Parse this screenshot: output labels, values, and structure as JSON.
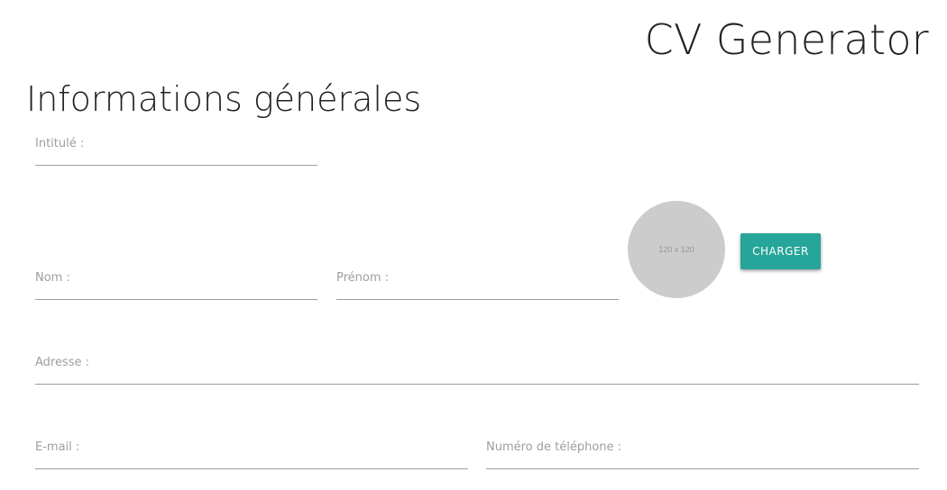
{
  "header": {
    "app_title": "CV Generator"
  },
  "section": {
    "title": "Informations générales"
  },
  "form": {
    "intitule": {
      "label": "Intitulé :",
      "value": ""
    },
    "nom": {
      "label": "Nom :",
      "value": ""
    },
    "prenom": {
      "label": "Prénom :",
      "value": ""
    },
    "adresse": {
      "label": "Adresse :",
      "value": ""
    },
    "email": {
      "label": "E-mail :",
      "value": ""
    },
    "telephone": {
      "label": "Numéro de téléphone :",
      "value": ""
    }
  },
  "photo": {
    "placeholder_text": "120 x 120",
    "upload_label": "CHARGER"
  },
  "colors": {
    "accent": "#26a69a",
    "avatar_bg": "#cccccc",
    "label": "#9e9e9e",
    "underline": "#9e9e9e"
  }
}
